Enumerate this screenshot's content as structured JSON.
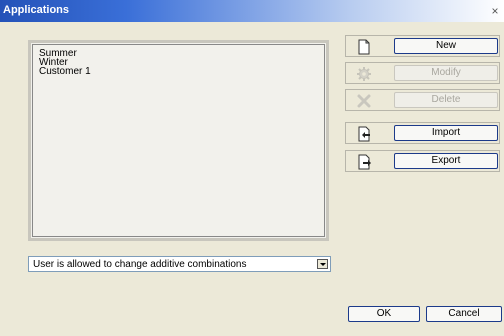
{
  "window": {
    "title": "Applications",
    "close_glyph": "×"
  },
  "list": {
    "items": [
      "Summer",
      "Winter",
      "Customer 1"
    ]
  },
  "permission_select": {
    "selected": "User is allowed to change additive combinations"
  },
  "actions": {
    "new": {
      "label": "New",
      "icon": "new-document-icon",
      "enabled": true
    },
    "modify": {
      "label": "Modify",
      "icon": "gear-icon",
      "enabled": false
    },
    "delete": {
      "label": "Delete",
      "icon": "delete-x-icon",
      "enabled": false
    },
    "import": {
      "label": "Import",
      "icon": "import-icon",
      "enabled": true
    },
    "export": {
      "label": "Export",
      "icon": "export-icon",
      "enabled": true
    }
  },
  "footer": {
    "ok_label": "OK",
    "cancel_label": "Cancel"
  },
  "colors": {
    "titlebar": "#2452b8",
    "accent_border": "#1c3a8a"
  }
}
